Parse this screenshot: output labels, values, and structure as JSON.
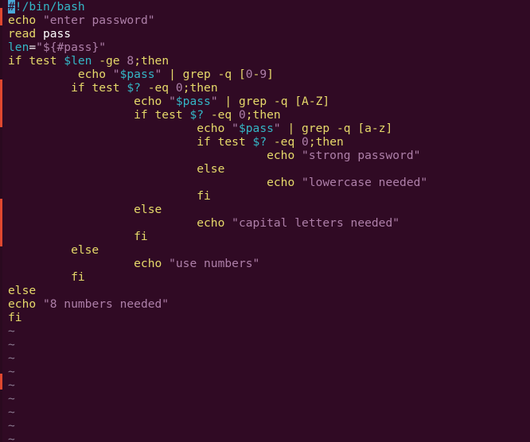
{
  "editor": {
    "lines": [
      [
        {
          "t": "#",
          "c": "cursor"
        },
        {
          "t": "!/bin/bash",
          "c": "comment"
        }
      ],
      [
        {
          "t": "echo",
          "c": "kw"
        },
        {
          "t": " ",
          "c": "plain"
        },
        {
          "t": "\"enter password\"",
          "c": "str"
        }
      ],
      [
        {
          "t": "read",
          "c": "kw"
        },
        {
          "t": " pass",
          "c": "plain"
        }
      ],
      [
        {
          "t": "len",
          "c": "var"
        },
        {
          "t": "=",
          "c": "plain"
        },
        {
          "t": "\"${#pass}\"",
          "c": "str"
        }
      ],
      [
        {
          "t": "if test ",
          "c": "kw"
        },
        {
          "t": "$len",
          "c": "var"
        },
        {
          "t": " -ge ",
          "c": "kw"
        },
        {
          "t": "8",
          "c": "num"
        },
        {
          "t": ";then",
          "c": "kw"
        }
      ],
      [
        {
          "t": "          echo ",
          "c": "kw"
        },
        {
          "t": "\"",
          "c": "str"
        },
        {
          "t": "$pass",
          "c": "var"
        },
        {
          "t": "\"",
          "c": "str"
        },
        {
          "t": " | grep -q [",
          "c": "kw"
        },
        {
          "t": "0",
          "c": "num"
        },
        {
          "t": "-",
          "c": "kw"
        },
        {
          "t": "9",
          "c": "num"
        },
        {
          "t": "]",
          "c": "kw"
        }
      ],
      [
        {
          "t": "         if test ",
          "c": "kw"
        },
        {
          "t": "$?",
          "c": "var"
        },
        {
          "t": " -eq ",
          "c": "kw"
        },
        {
          "t": "0",
          "c": "num"
        },
        {
          "t": ";then",
          "c": "kw"
        }
      ],
      [
        {
          "t": "                  echo ",
          "c": "kw"
        },
        {
          "t": "\"",
          "c": "str"
        },
        {
          "t": "$pass",
          "c": "var"
        },
        {
          "t": "\"",
          "c": "str"
        },
        {
          "t": " | grep -q [A-Z]",
          "c": "kw"
        }
      ],
      [
        {
          "t": "                  if test ",
          "c": "kw"
        },
        {
          "t": "$?",
          "c": "var"
        },
        {
          "t": " -eq ",
          "c": "kw"
        },
        {
          "t": "0",
          "c": "num"
        },
        {
          "t": ";then",
          "c": "kw"
        }
      ],
      [
        {
          "t": "                           echo ",
          "c": "kw"
        },
        {
          "t": "\"",
          "c": "str"
        },
        {
          "t": "$pass",
          "c": "var"
        },
        {
          "t": "\"",
          "c": "str"
        },
        {
          "t": " | grep -q [a-z]",
          "c": "kw"
        }
      ],
      [
        {
          "t": "                           if test ",
          "c": "kw"
        },
        {
          "t": "$?",
          "c": "var"
        },
        {
          "t": " -eq ",
          "c": "kw"
        },
        {
          "t": "0",
          "c": "num"
        },
        {
          "t": ";then",
          "c": "kw"
        }
      ],
      [
        {
          "t": "                                     echo ",
          "c": "kw"
        },
        {
          "t": "\"strong password\"",
          "c": "str"
        }
      ],
      [
        {
          "t": "                           else",
          "c": "kw"
        }
      ],
      [
        {
          "t": "                                     echo ",
          "c": "kw"
        },
        {
          "t": "\"lowercase needed\"",
          "c": "str"
        }
      ],
      [
        {
          "t": "                           fi",
          "c": "kw"
        }
      ],
      [
        {
          "t": "                  else",
          "c": "kw"
        }
      ],
      [
        {
          "t": "                           echo ",
          "c": "kw"
        },
        {
          "t": "\"capital letters needed\"",
          "c": "str"
        }
      ],
      [
        {
          "t": "                  fi",
          "c": "kw"
        }
      ],
      [
        {
          "t": "         else",
          "c": "kw"
        }
      ],
      [
        {
          "t": "                  echo ",
          "c": "kw"
        },
        {
          "t": "\"use numbers\"",
          "c": "str"
        }
      ],
      [
        {
          "t": "         fi",
          "c": "kw"
        }
      ],
      [
        {
          "t": "else",
          "c": "kw"
        }
      ],
      [
        {
          "t": "echo ",
          "c": "kw"
        },
        {
          "t": "\"8 numbers needed\"",
          "c": "str"
        }
      ],
      [
        {
          "t": "fi",
          "c": "kw"
        }
      ],
      [
        {
          "t": "~",
          "c": "tilde"
        }
      ],
      [
        {
          "t": "~",
          "c": "tilde"
        }
      ],
      [
        {
          "t": "~",
          "c": "tilde"
        }
      ],
      [
        {
          "t": "~",
          "c": "tilde"
        }
      ],
      [
        {
          "t": "~",
          "c": "tilde"
        }
      ],
      [
        {
          "t": "~",
          "c": "tilde"
        }
      ],
      [
        {
          "t": "~",
          "c": "tilde"
        }
      ],
      [
        {
          "t": "~",
          "c": "tilde"
        }
      ],
      [
        {
          "t": "~",
          "c": "tilde"
        }
      ]
    ]
  },
  "colors": {
    "background": "#300a24",
    "comment": "#34b6c6",
    "keyword": "#e6d96a",
    "string": "#ad7fa8",
    "variable": "#34b6c6",
    "number": "#ad7fa8",
    "cursor": "#4aa8d8",
    "tilde": "#8a7a90"
  }
}
